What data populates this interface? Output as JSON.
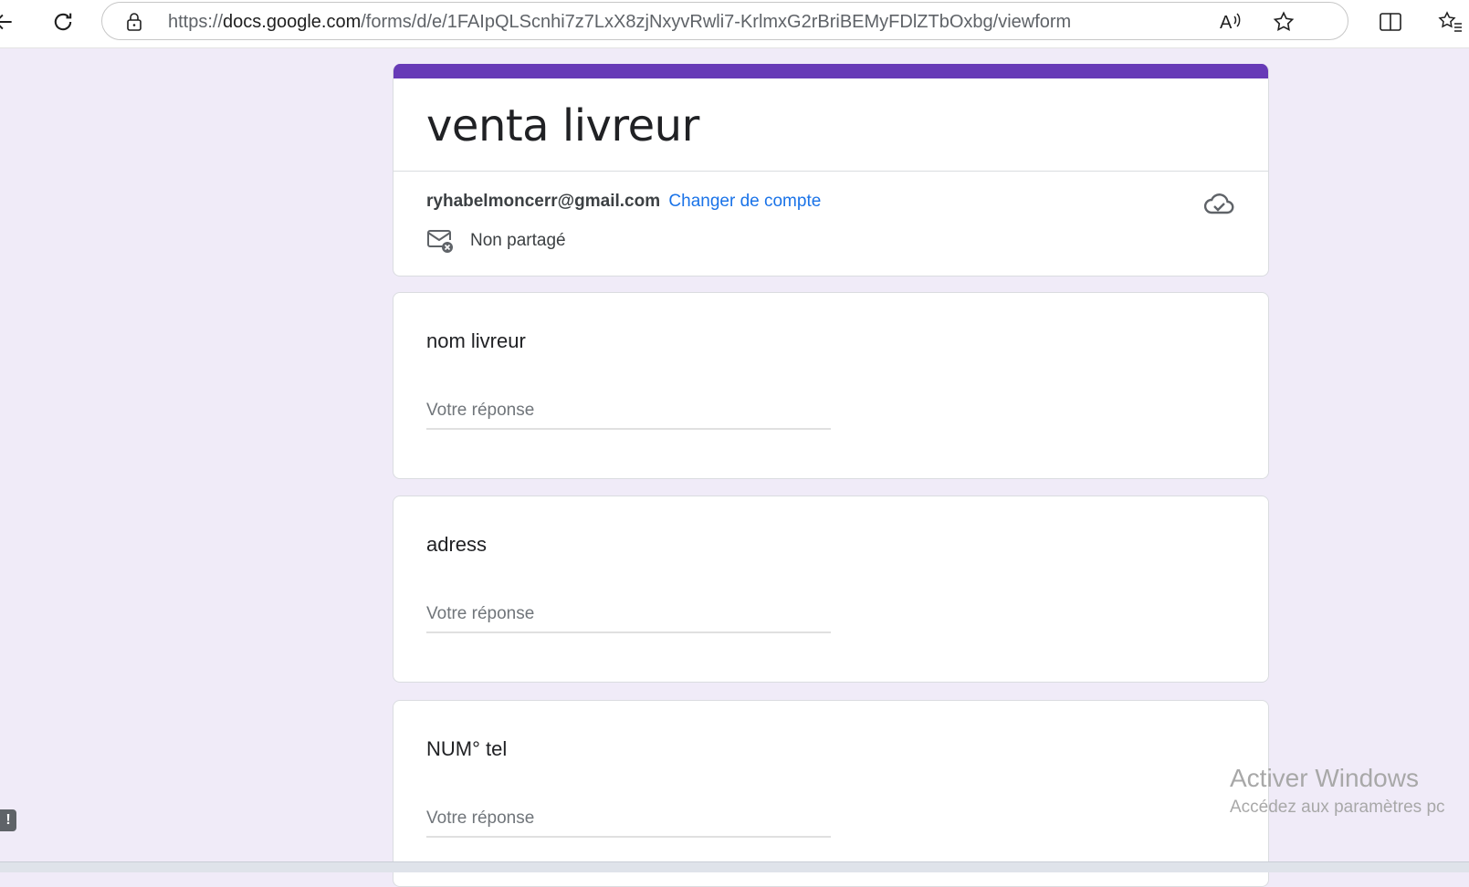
{
  "browser": {
    "url_prefix": "https://",
    "url_host": "docs.google.com",
    "url_path": "/forms/d/e/1FAIpQLScnhi7z7LxX8zjNxyvRwli7-KrlmxG2rBriBEMyFDlZTbOxbg/viewform",
    "icons": {
      "back": "arrow-left-icon",
      "refresh": "refresh-icon",
      "lock": "lock-icon",
      "read_aloud": "read-aloud-icon",
      "favorite": "star-icon",
      "split_screen": "split-screen-icon",
      "favorites_bar": "favorites-icon"
    }
  },
  "form": {
    "accent_color": "#673ab7",
    "title": "venta livreur",
    "account_email": "ryhabelmoncerr@gmail.com",
    "switch_account_label": "Changer de compte",
    "share_status": "Non partagé",
    "questions": [
      {
        "title": "nom livreur",
        "placeholder": "Votre réponse"
      },
      {
        "title": "adress",
        "placeholder": "Votre réponse"
      },
      {
        "title": "NUM° tel",
        "placeholder": "Votre réponse"
      }
    ]
  },
  "watermark": {
    "title": "Activer Windows",
    "subtitle": "Accédez aux paramètres pc"
  },
  "feedback_label": "!"
}
